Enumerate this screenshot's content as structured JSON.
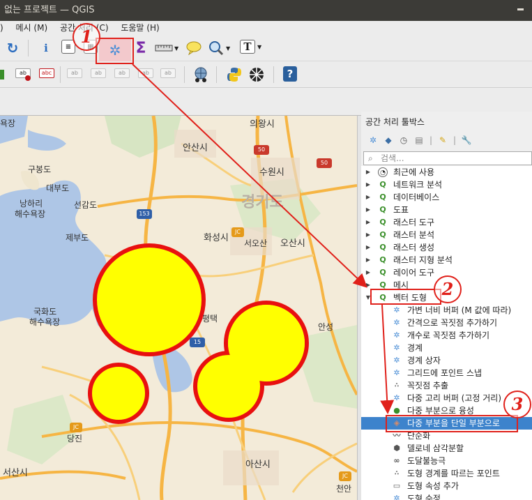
{
  "window": {
    "title": "없는 프로젝트 — QGIS"
  },
  "menubar": {
    "items": [
      ") ",
      "메시 (M)",
      "공간 처리 (C)",
      "도움말 (H)"
    ]
  },
  "toolbar1": {
    "refresh_icon": "refresh-icon",
    "identify_icon": "identify-icon",
    "attribute_table_icon": "attribute-table-icon",
    "statistics_icon": "statistics-icon",
    "processing_toolbox_icon": "gear-icon",
    "sum_label": "Σ",
    "measure_icon": "ruler-icon",
    "tips_icon": "speech-bubble-icon",
    "zoom_icon": "zoom-icon",
    "text_annotation_label": "T"
  },
  "toolbar2": {
    "label_abc_1": "ab",
    "label_abc_2": "abc"
  },
  "map": {
    "labels": {
      "uiwang": "의왕시",
      "ansan": "안산시",
      "suwon": "수원시",
      "gyeonggido": "경기도",
      "hwaseong": "화성시",
      "seoosan": "서오산",
      "osan": "오산시",
      "gurngdo": "구봉도",
      "daebudo": "대부도",
      "seongamdo": "선감도",
      "nanghwari": "낭하리",
      "beach1": "해수욕장",
      "jebudo": "제부도",
      "gukhwado": "국화도",
      "beach2": "해수욕장",
      "pyeongtaek": "평택",
      "anseong": "안성",
      "dangjin": "당진",
      "asan": "아산시",
      "seosan": "서산시",
      "cheonan": "천안",
      "beach_top": "욕장",
      "road50a": "50",
      "road50b": "50",
      "road153": "153",
      "road15": "15",
      "jc1": "JC",
      "jc2": "JC",
      "jc3": "JC"
    }
  },
  "toolbox": {
    "title": "공간 처리 툴박스",
    "search_placeholder": "검색...",
    "categories": [
      {
        "label": "최근에 사용",
        "icon": "clock-icon"
      },
      {
        "label": "네트워크 분석",
        "icon": "qgis-icon"
      },
      {
        "label": "데이터베이스",
        "icon": "qgis-icon"
      },
      {
        "label": "도표",
        "icon": "qgis-icon"
      },
      {
        "label": "래스터 도구",
        "icon": "qgis-icon"
      },
      {
        "label": "래스터 분석",
        "icon": "qgis-icon"
      },
      {
        "label": "래스터 생성",
        "icon": "qgis-icon"
      },
      {
        "label": "래스터 지형 분석",
        "icon": "qgis-icon"
      },
      {
        "label": "레이어 도구",
        "icon": "qgis-icon"
      },
      {
        "label": "메시",
        "icon": "qgis-icon"
      },
      {
        "label": "벡터 도형",
        "icon": "qgis-icon"
      }
    ],
    "algorithms": [
      "가변 너비 버퍼 (M 값에 따라)",
      "간격으로 꼭짓점 추가하기",
      "개수로 꼭짓점 추가하기",
      "경계",
      "경계 상자",
      "그리드에 포인트 스냅",
      "꼭짓점 추출",
      "다중 고리 버퍼 (고정 거리)",
      "다중 부분으로 융성",
      "다중 부분을 단일 부분으로",
      "단순화",
      "델로네 삼각분할",
      "도달불능극",
      "도형 경계를 따르는 포인트",
      "도형 속성 추가",
      "도형 수정"
    ]
  },
  "annotations": {
    "step1": "1",
    "step2": "2",
    "step3": "3"
  },
  "colors": {
    "annotation": "#e0201a",
    "buffer_fill": "#ffff00",
    "buffer_outline": "#e81010",
    "selection": "#3d83cc"
  }
}
